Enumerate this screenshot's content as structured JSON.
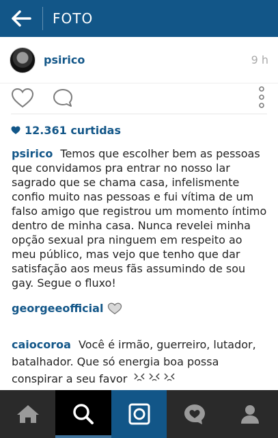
{
  "topbar": {
    "title": "FOTO"
  },
  "post": {
    "username": "psirico",
    "time": "9 h",
    "likes": "12.361 curtidas",
    "caption_user": "psirico",
    "caption_text": "Temos que escolher bem as pessoas que convidamos pra entrar no nosso lar sagrado que se chama casa, infelismente confio muito nas pessoas e fui vítima de um falso amigo que registrou um momento íntimo dentro de minha casa. Nunca revelei minha opção sexual pra ninguem em respeito ao meu público, mas vejo que tenho que dar satisfação aos meus fãs assumindo de sou gay. Segue o fluxo!"
  },
  "comments": [
    {
      "user": "georgeeofficial",
      "text": ""
    },
    {
      "user": "caiocoroa",
      "text": "Você é irmão, guerreiro, lutador, batalhador. Que só energia boa possa conspirar a seu favor"
    }
  ],
  "icons": {
    "back": "arrow-left-icon",
    "heart": "heart-outline-icon",
    "comment": "comment-bubble-icon",
    "more": "more-vertical-icon",
    "emoji": "kissing-face-emoji-icon"
  },
  "colors": {
    "brand": "#125688",
    "tabbar": "#2a2a2a",
    "active_tab": "#000000"
  }
}
